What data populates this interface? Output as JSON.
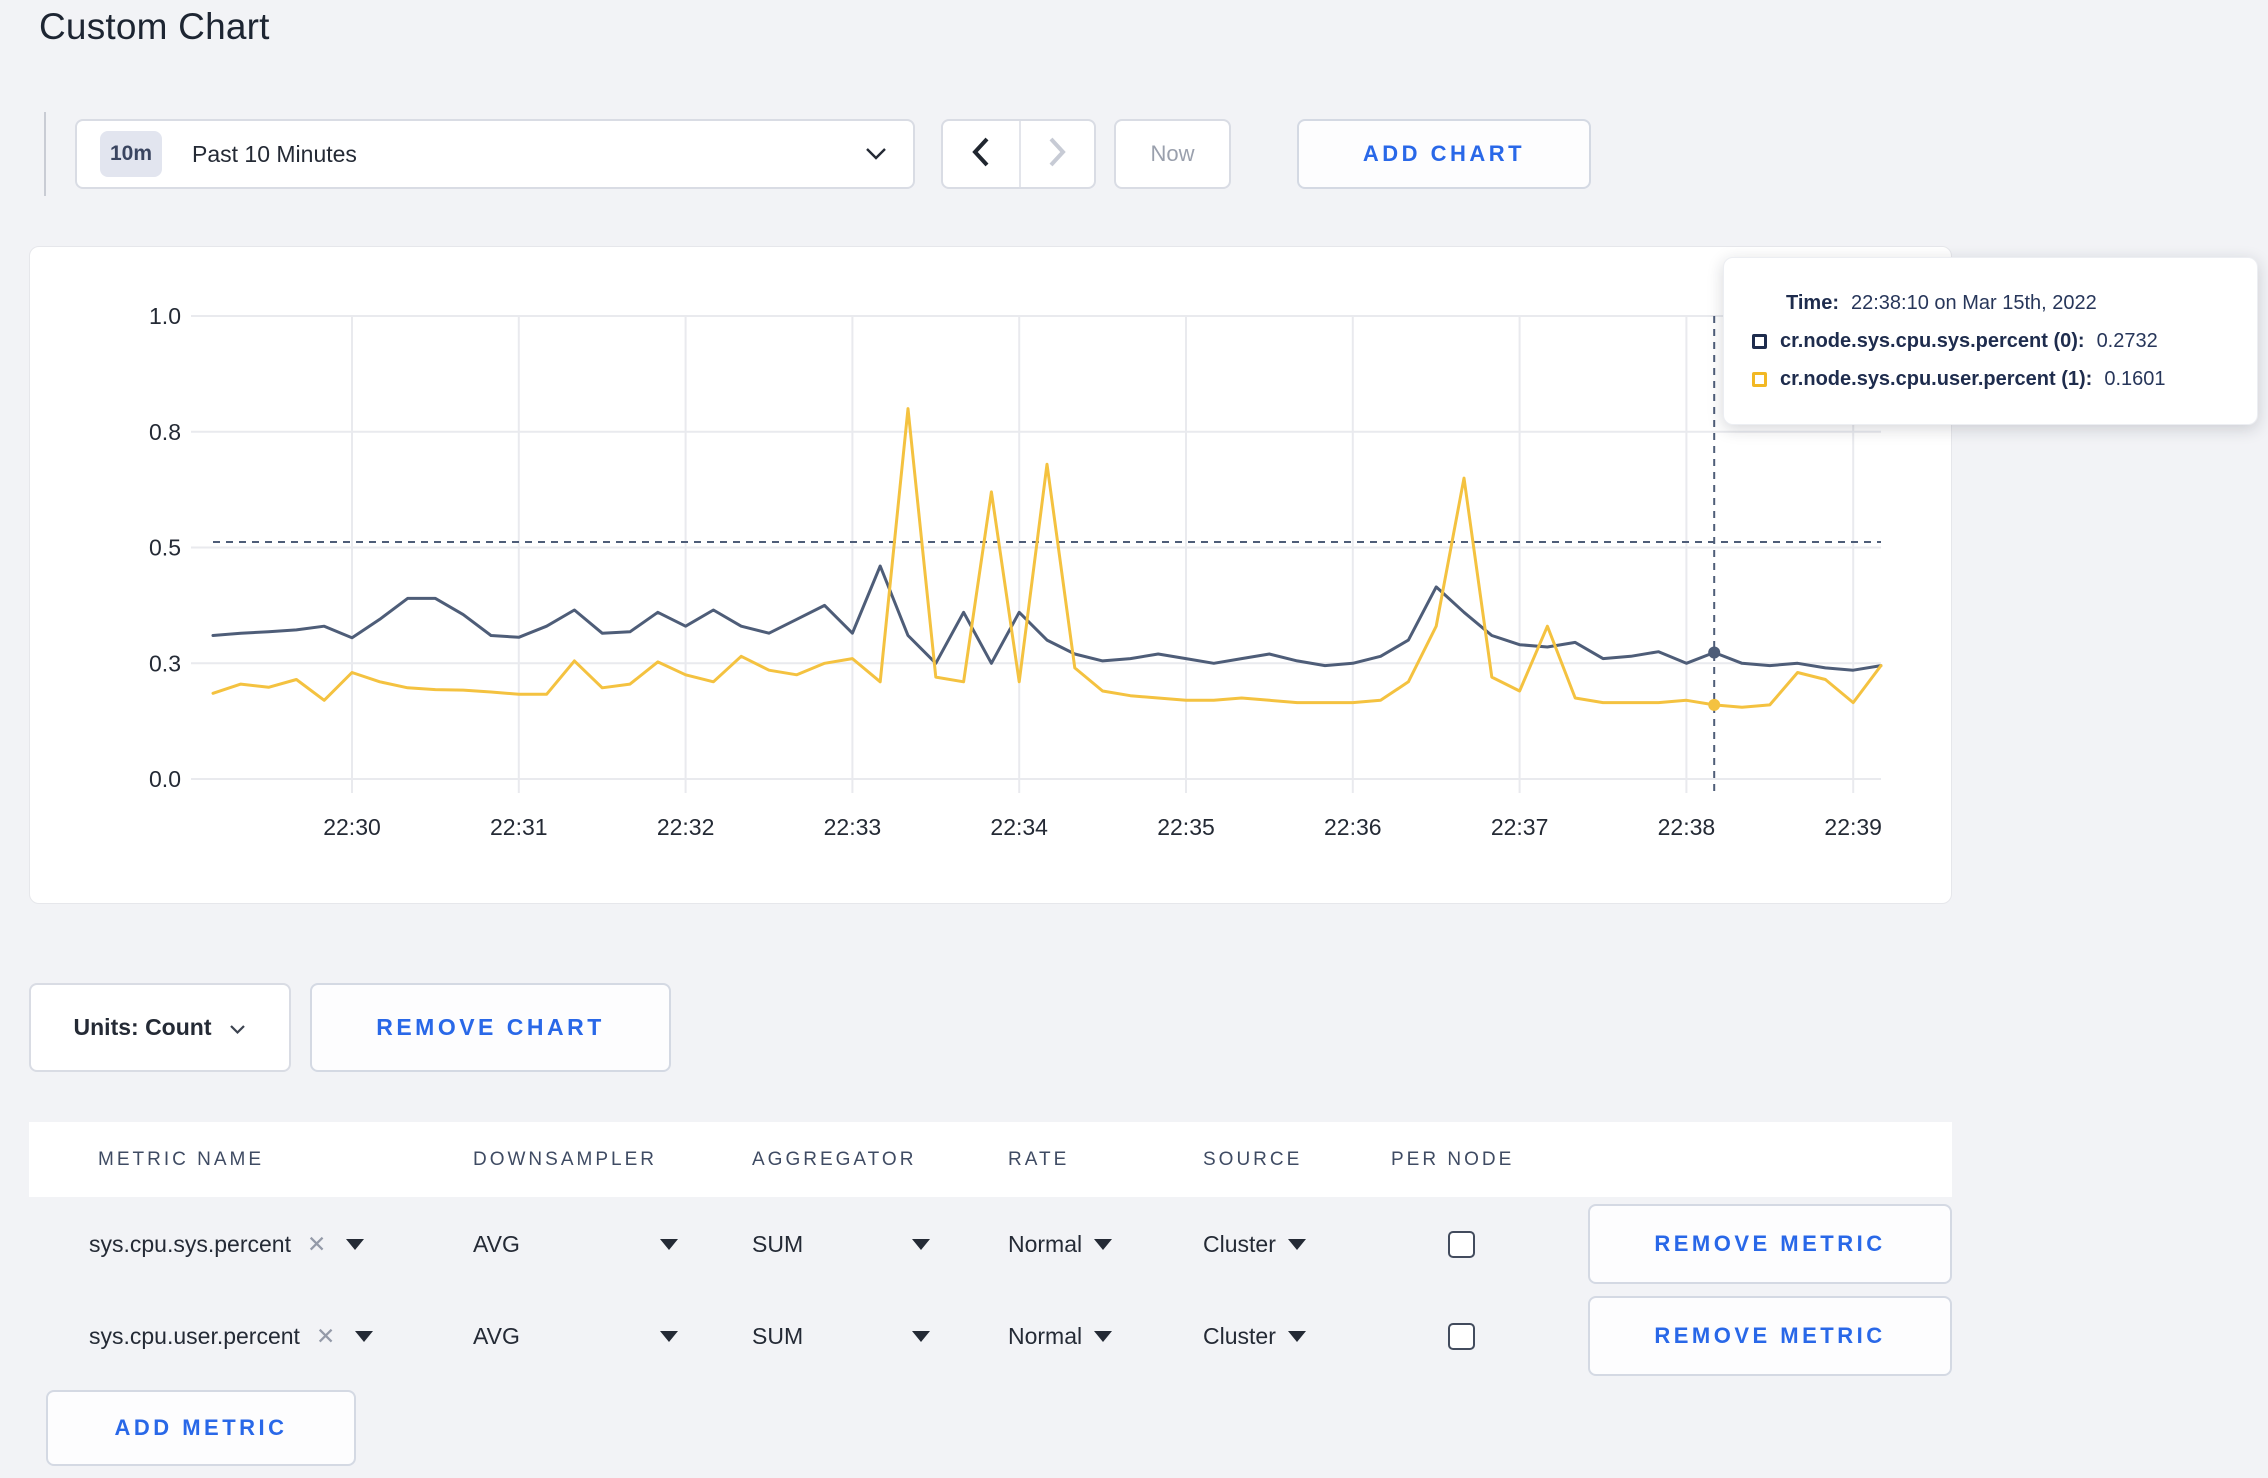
{
  "page": {
    "title": "Custom Chart"
  },
  "toolbar": {
    "time_range": {
      "badge": "10m",
      "label": "Past 10 Minutes"
    },
    "now_label": "Now",
    "add_chart_label": "ADD CHART"
  },
  "colors": {
    "accent_blue": "#2968e8",
    "series_sys": "#4e5d78",
    "series_user": "#f4c240",
    "grid": "#e9eaee",
    "crosshair": "#4e5d78",
    "navy_text": "#1e2c4d"
  },
  "chart_data": {
    "type": "line",
    "title": "",
    "xlabel": "",
    "ylabel": "",
    "ylim": [
      0,
      1
    ],
    "grid": true,
    "legend_position": "none",
    "x_start": "22:29:10",
    "x_end": "22:39:10",
    "interval_seconds": 10,
    "x_tick_labels": [
      "22:30",
      "22:31",
      "22:32",
      "22:33",
      "22:34",
      "22:35",
      "22:36",
      "22:37",
      "22:38",
      "22:39"
    ],
    "x_tick_indices": [
      5,
      11,
      17,
      23,
      29,
      35,
      41,
      47,
      53,
      59
    ],
    "y_tick_labels": [
      "0.0",
      "0.3",
      "0.5",
      "0.8",
      "1.0"
    ],
    "y_tick_values": [
      0,
      0.25,
      0.5,
      0.75,
      1.0
    ],
    "series": [
      {
        "name": "cr.node.sys.cpu.sys.percent (0)",
        "color": "#4e5d78",
        "values": [
          0.31,
          0.315,
          0.318,
          0.322,
          0.33,
          0.305,
          0.345,
          0.39,
          0.39,
          0.355,
          0.31,
          0.306,
          0.33,
          0.365,
          0.315,
          0.318,
          0.36,
          0.33,
          0.365,
          0.33,
          0.315,
          0.345,
          0.375,
          0.315,
          0.46,
          0.31,
          0.25,
          0.36,
          0.25,
          0.36,
          0.3,
          0.27,
          0.255,
          0.26,
          0.27,
          0.26,
          0.25,
          0.26,
          0.27,
          0.255,
          0.245,
          0.25,
          0.265,
          0.3,
          0.415,
          0.36,
          0.31,
          0.29,
          0.285,
          0.295,
          0.26,
          0.265,
          0.275,
          0.25,
          0.2732,
          0.25,
          0.245,
          0.25,
          0.24,
          0.235,
          0.245
        ]
      },
      {
        "name": "cr.node.sys.cpu.user.percent (1)",
        "color": "#f4c240",
        "values": [
          0.185,
          0.205,
          0.198,
          0.215,
          0.17,
          0.23,
          0.21,
          0.197,
          0.193,
          0.192,
          0.188,
          0.183,
          0.183,
          0.255,
          0.197,
          0.205,
          0.253,
          0.225,
          0.21,
          0.265,
          0.235,
          0.225,
          0.25,
          0.26,
          0.21,
          0.8,
          0.22,
          0.21,
          0.62,
          0.21,
          0.68,
          0.24,
          0.19,
          0.18,
          0.175,
          0.17,
          0.17,
          0.175,
          0.17,
          0.165,
          0.165,
          0.165,
          0.17,
          0.21,
          0.33,
          0.65,
          0.22,
          0.19,
          0.33,
          0.175,
          0.165,
          0.165,
          0.165,
          0.17,
          0.1601,
          0.155,
          0.16,
          0.23,
          0.215,
          0.165,
          0.245
        ]
      }
    ],
    "crosshair": {
      "index": 54,
      "time": "22:38:10",
      "mouse_y_value": 0.512
    }
  },
  "tooltip": {
    "time_label": "Time:",
    "time_value": "22:38:10 on Mar 15th, 2022",
    "rows": [
      {
        "label": "cr.node.sys.cpu.sys.percent (0):",
        "value": "0.2732",
        "color": "#1e2c4d"
      },
      {
        "label": "cr.node.sys.cpu.user.percent (1):",
        "value": "0.1601",
        "color": "#f2b824"
      }
    ]
  },
  "units_bar": {
    "units_label": "Units: Count",
    "remove_chart_label": "REMOVE CHART"
  },
  "table": {
    "headers": [
      "METRIC NAME",
      "DOWNSAMPLER",
      "AGGREGATOR",
      "RATE",
      "SOURCE",
      "PER NODE"
    ],
    "rows": [
      {
        "metric": "sys.cpu.sys.percent",
        "remove_icon": "✕",
        "downsampler": "AVG",
        "aggregator": "SUM",
        "rate": "Normal",
        "source": "Cluster",
        "per_node_checked": false,
        "remove_label": "REMOVE METRIC"
      },
      {
        "metric": "sys.cpu.user.percent",
        "remove_icon": "✕",
        "downsampler": "AVG",
        "aggregator": "SUM",
        "rate": "Normal",
        "source": "Cluster",
        "per_node_checked": false,
        "remove_label": "REMOVE METRIC"
      }
    ],
    "add_metric_label": "ADD METRIC"
  }
}
